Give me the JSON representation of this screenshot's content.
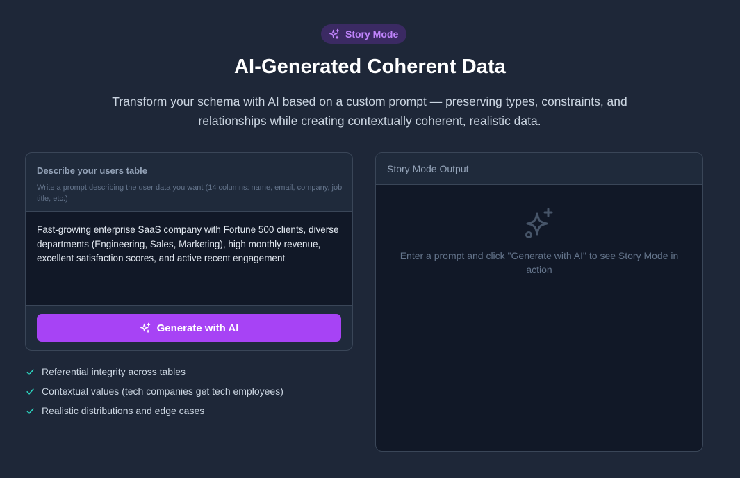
{
  "badge": {
    "label": "Story Mode",
    "icon": "sparkles-icon"
  },
  "hero": {
    "title": "AI-Generated Coherent Data",
    "subtitle": "Transform your schema with AI based on a custom prompt — preserving types, constraints, and relationships while creating contextually coherent, realistic data."
  },
  "input_card": {
    "title": "Describe your users table",
    "hint": "Write a prompt describing the user data you want (14 columns: name, email, company, job title, etc.)",
    "prompt_value": "Fast-growing enterprise SaaS company with Fortune 500 clients, diverse departments (Engineering, Sales, Marketing), high monthly revenue, excellent satisfaction scores, and active recent engagement",
    "generate_button": "Generate with AI"
  },
  "features": [
    {
      "label": "Referential integrity across tables",
      "icon": "check-icon"
    },
    {
      "label": "Contextual values (tech companies get tech employees)",
      "icon": "check-icon"
    },
    {
      "label": "Realistic distributions and edge cases",
      "icon": "check-icon"
    }
  ],
  "output_card": {
    "title": "Story Mode Output",
    "empty_message": "Enter a prompt and click \"Generate with AI\" to see Story Mode in action"
  },
  "colors": {
    "background": "#1e2738",
    "accent": "#a743f5",
    "badge_text": "#c084fc",
    "check": "#2dd4bf"
  }
}
